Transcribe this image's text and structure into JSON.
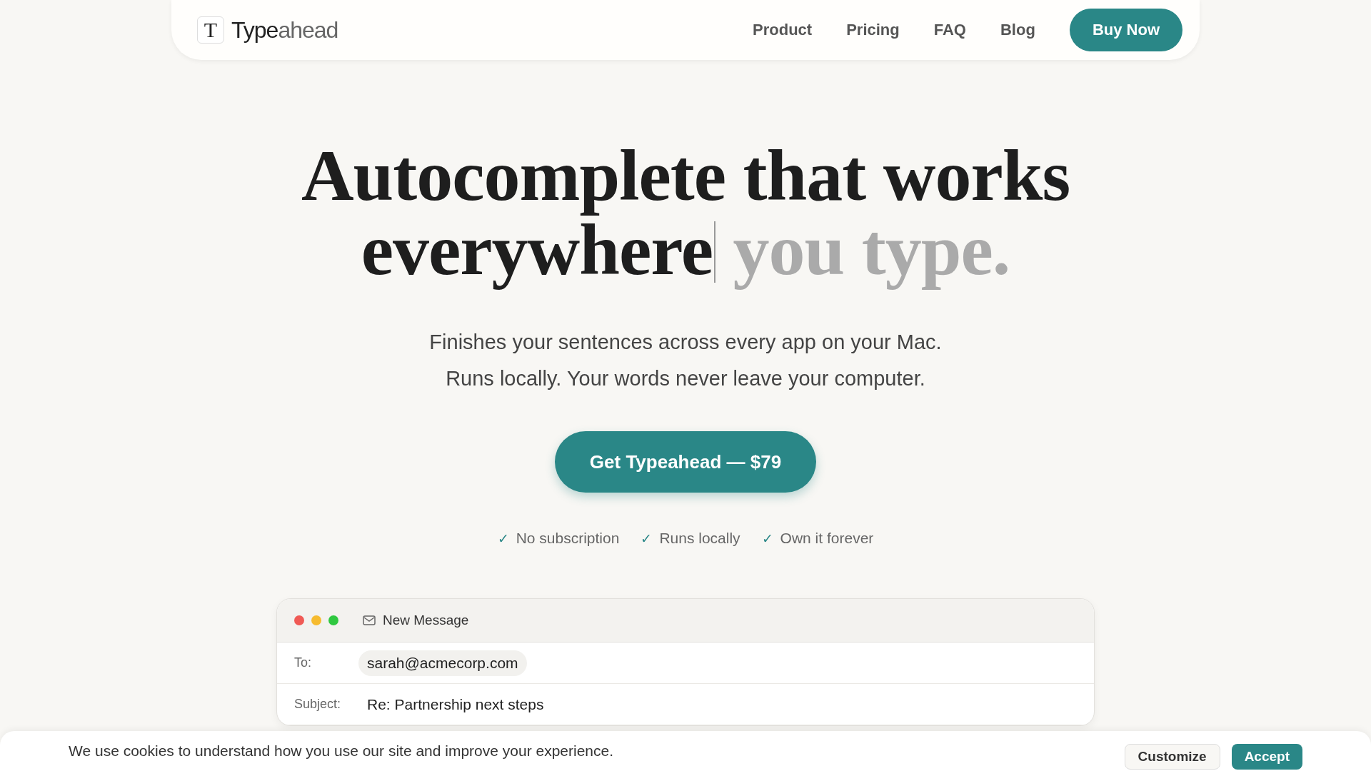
{
  "nav": {
    "brand_main": "Type",
    "brand_suffix": "ahead",
    "logo_letter": "T",
    "links": [
      "Product",
      "Pricing",
      "FAQ",
      "Blog"
    ],
    "cta": "Buy Now"
  },
  "hero": {
    "headline_typed": "Autocomplete that works everywhere",
    "headline_suggestion": "you type.",
    "subtitle_lines": [
      "Finishes your sentences across every app on your Mac.",
      "Runs locally. Your words never leave your computer."
    ],
    "cta": "Get Typeahead — $79",
    "check_mark": "✓",
    "benefits": [
      "No subscription",
      "Runs locally",
      "Own it forever"
    ]
  },
  "email": {
    "title": "New Message",
    "fields": [
      {
        "label": "To:",
        "value": "sarah@acmecorp.com",
        "kind": "chip"
      },
      {
        "label": "Subject:",
        "value": "Re: Partnership next steps",
        "kind": "text"
      }
    ]
  },
  "cookie_banner": {
    "text": "We use cookies to understand how you use our site and improve your experience.",
    "buttons": [
      {
        "label": "Customize",
        "kind": "secondary"
      },
      {
        "label": "Accept",
        "kind": "primary"
      }
    ]
  }
}
